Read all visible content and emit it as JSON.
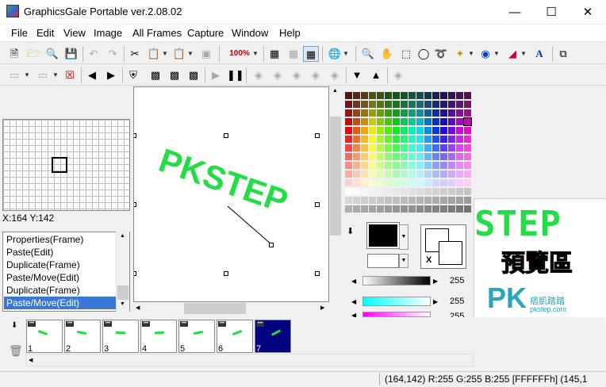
{
  "window": {
    "title": "GraphicsGale Portable ver.2.08.02"
  },
  "menu": [
    "File",
    "Edit",
    "View",
    "Image",
    "All Frames",
    "Capture",
    "Window",
    "Help"
  ],
  "toolbar1": {
    "zoom_value": "100%"
  },
  "navigator": {
    "coords": "X:164 Y:142"
  },
  "history": {
    "items": [
      "Properties(Frame)",
      "Paste(Edit)",
      "Duplicate(Frame)",
      "Paste/Move(Edit)",
      "Duplicate(Frame)",
      "Paste/Move(Edit)"
    ],
    "selected_index": 5
  },
  "canvas": {
    "text": "PKSTEP",
    "text_color": "#22dd44"
  },
  "color_panel": {
    "slider_value_1": "255",
    "slider_value_2": "255",
    "slider_value_3": "255",
    "bg_label": "X"
  },
  "preview": {
    "text": "STEP",
    "overlay_text": "預覽區",
    "overlay_color": "#ff5522"
  },
  "frames": {
    "numbers": [
      "1",
      "2",
      "3",
      "4",
      "5",
      "6",
      "7"
    ],
    "selected": 7
  },
  "watermark": {
    "logo": "PK",
    "sub_cjk": "痞凱踏踏",
    "sub_url": "pkstep.com"
  },
  "status": {
    "text": "(164,142) R:255 G:255 B:255  [FFFFFFh]  (145,1"
  },
  "colors": {
    "accent": "#3a78d7",
    "frame_selected": "#000080",
    "canvas_text": "#22dd44"
  }
}
